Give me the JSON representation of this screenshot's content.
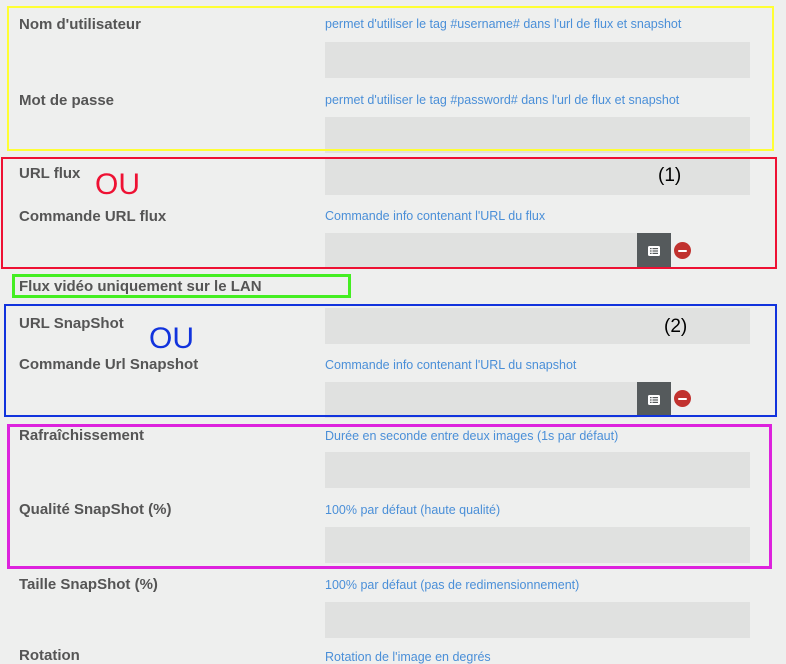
{
  "form": {
    "username_label": "Nom d'utilisateur",
    "username_help": "permet d'utiliser le tag #username# dans l'url de flux et snapshot",
    "password_label": "Mot de passe",
    "password_help": "permet d'utiliser le tag #password# dans l'url de flux et snapshot",
    "url_flux_label": "URL flux",
    "cmd_url_flux_label": "Commande URL flux",
    "cmd_url_flux_help": "Commande info contenant l'URL du flux",
    "lan_only_label": "Flux vidéo uniquement sur le LAN",
    "url_snapshot_label": "URL SnapShot",
    "cmd_url_snapshot_label": "Commande Url Snapshot",
    "cmd_url_snapshot_help": "Commande info contenant l'URL du snapshot",
    "refresh_label": "Rafraîchissement",
    "refresh_help": "Durée en seconde entre deux images (1s par défaut)",
    "quality_label": "Qualité SnapShot (%)",
    "quality_help": "100% par défaut (haute qualité)",
    "size_label": "Taille SnapShot (%)",
    "size_help": "100% par défaut (pas de redimensionnement)",
    "next_label": "Rotation",
    "next_help": "Rotation de l'image en degrés"
  },
  "annotations": {
    "ou_1": "OU",
    "ou_2": "OU",
    "note_1": "(1)",
    "note_2": "(2)",
    "colors": {
      "yellow": "#ffff33",
      "red": "#ee1133",
      "green": "#44ee22",
      "blue": "#1133dd",
      "magenta": "#dd22dd"
    }
  },
  "icons": {
    "list": "list-icon",
    "remove": "minus-circle-icon"
  }
}
